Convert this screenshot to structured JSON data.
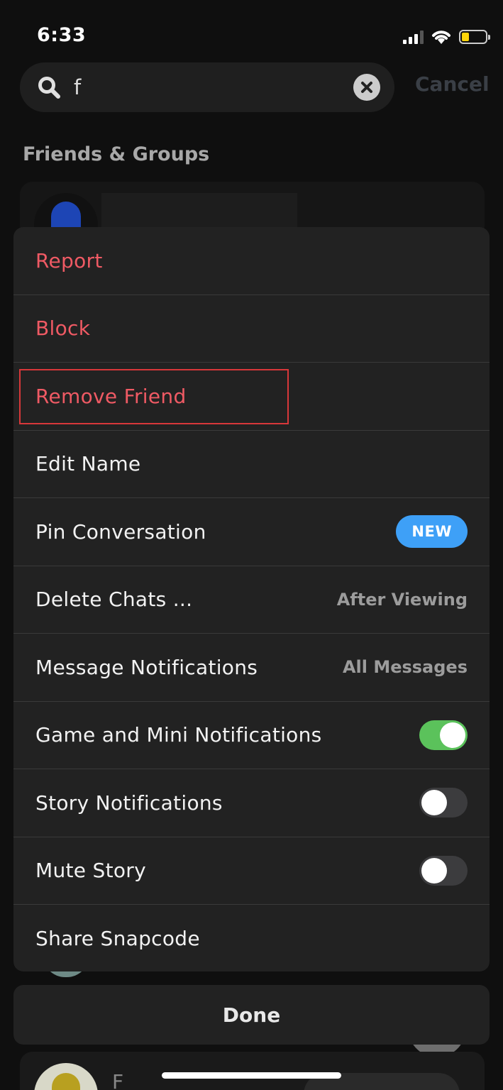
{
  "status_bar": {
    "time": "6:33"
  },
  "search": {
    "query": "f",
    "cancel_label": "Cancel"
  },
  "section": {
    "title": "Friends & Groups"
  },
  "menu": {
    "report": "Report",
    "block": "Block",
    "remove_friend": "Remove Friend",
    "edit_name": "Edit Name",
    "pin_conversation": "Pin Conversation",
    "pin_badge": "NEW",
    "delete_chats": "Delete Chats ...",
    "delete_chats_value": "After Viewing",
    "message_notifications": "Message Notifications",
    "message_notifications_value": "All Messages",
    "game_notifications": "Game and Mini Notifications",
    "story_notifications": "Story Notifications",
    "mute_story": "Mute Story",
    "share_snapcode": "Share Snapcode"
  },
  "toggles": {
    "game_notifications": true,
    "story_notifications": false,
    "mute_story": false
  },
  "done_label": "Done",
  "bottom_list": {
    "initial": "F"
  },
  "colors": {
    "danger": "#ef5a64",
    "badge": "#3ea0f7",
    "toggle_on": "#5bc25b",
    "highlight": "#d8373a",
    "battery": "#ffd60a"
  }
}
